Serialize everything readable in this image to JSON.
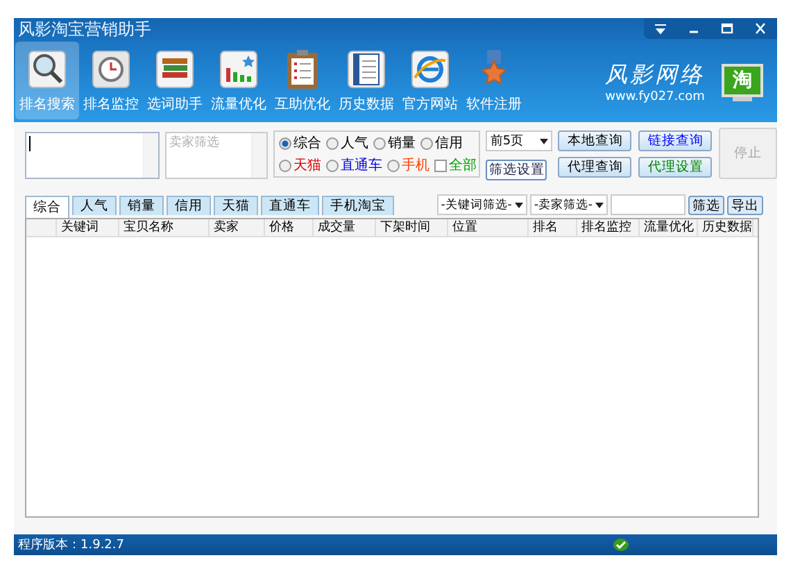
{
  "window": {
    "title": "风影淘宝营销助手"
  },
  "nav": [
    {
      "label": "排名搜索",
      "selected": true
    },
    {
      "label": "排名监控",
      "selected": false
    },
    {
      "label": "选词助手",
      "selected": false
    },
    {
      "label": "流量优化",
      "selected": false
    },
    {
      "label": "互助优化",
      "selected": false
    },
    {
      "label": "历史数据",
      "selected": false
    },
    {
      "label": "官方网站",
      "selected": false
    },
    {
      "label": "软件注册",
      "selected": false
    }
  ],
  "brand": {
    "name": "风影网络",
    "url": "www.fy027.com",
    "badge": "淘"
  },
  "search": {
    "seller": {
      "placeholder": "卖家筛选"
    }
  },
  "sort_options": [
    {
      "label": "综合",
      "selected": true,
      "color": "#000000"
    },
    {
      "label": "人气",
      "selected": false,
      "color": "#000000"
    },
    {
      "label": "销量",
      "selected": false,
      "color": "#000000"
    },
    {
      "label": "信用",
      "selected": false,
      "color": "#000000"
    }
  ],
  "platform_options": [
    {
      "label": "天猫",
      "kind": "radio",
      "selected": false,
      "color": "#e00000"
    },
    {
      "label": "直通车",
      "kind": "radio",
      "selected": false,
      "color": "#0000e0"
    },
    {
      "label": "手机",
      "kind": "radio",
      "selected": false,
      "color": "#ff4000"
    },
    {
      "label": "全部",
      "kind": "checkbox",
      "selected": false,
      "color": "#00a000"
    }
  ],
  "pages_dropdown": {
    "value": "前5页"
  },
  "buttons": [
    {
      "label": "本地查询",
      "color": "#000000",
      "disabled": false
    },
    {
      "label": "代理查询",
      "color": "#000000",
      "disabled": false
    },
    {
      "label": "链接查询",
      "color": "#0000ff",
      "disabled": false
    },
    {
      "label": "代理设置",
      "color": "#008000",
      "disabled": false
    }
  ],
  "stop_button": {
    "label": "停止",
    "disabled": true
  },
  "filter_settings_button": {
    "label": "筛选设置"
  },
  "tabs": [
    {
      "label": "综合",
      "selected": true
    },
    {
      "label": "人气",
      "selected": false
    },
    {
      "label": "销量",
      "selected": false
    },
    {
      "label": "信用",
      "selected": false
    },
    {
      "label": "天猫",
      "selected": false
    },
    {
      "label": "直通车",
      "selected": false
    },
    {
      "label": "手机淘宝",
      "selected": false
    }
  ],
  "filters": {
    "keyword_filter": "-关键词筛选-",
    "seller_filter": "-卖家筛选-",
    "filter_button": "筛选",
    "export_button": "导出"
  },
  "table": {
    "columns": [
      "",
      "关键词",
      "宝贝名称",
      "卖家",
      "价格",
      "成交量",
      "下架时间",
      "位置",
      "排名",
      "排名监控",
      "流量优化",
      "历史数据"
    ]
  },
  "status_bar": {
    "version": "程序版本：1.9.2.7"
  }
}
